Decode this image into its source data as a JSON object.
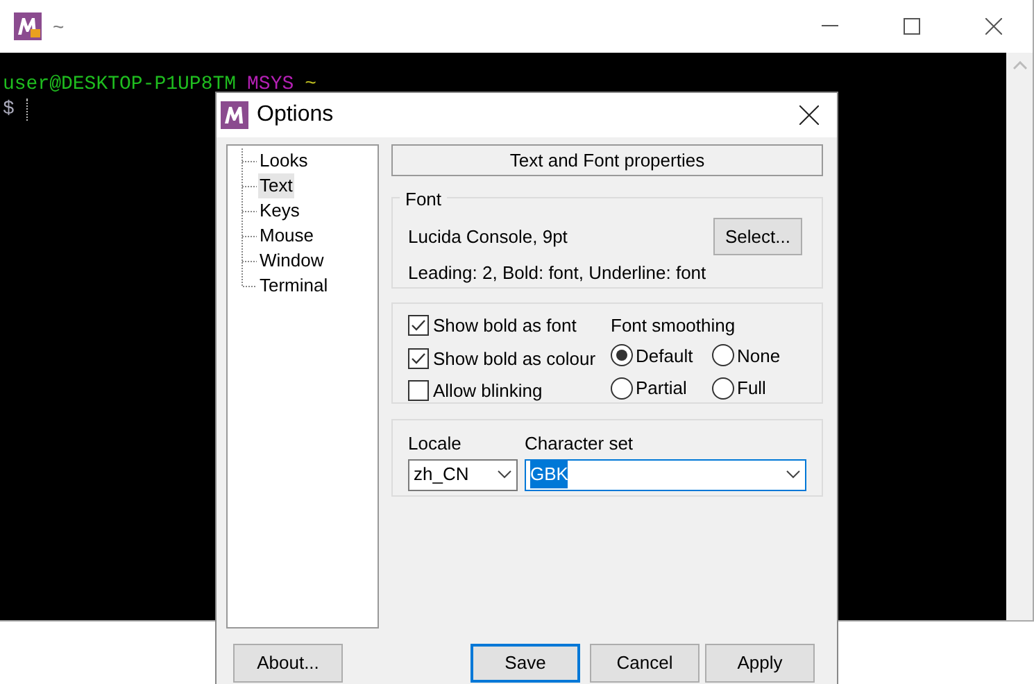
{
  "terminal": {
    "title": "~",
    "line_1": [
      {
        "text": "user@DESKTOP-P1UP8TM",
        "color": "#1fbd1f"
      },
      {
        "text": "MSYS",
        "color": "#b520b5"
      },
      {
        "text": "~",
        "color": "#bfbf20"
      }
    ],
    "prompt": "$"
  },
  "dialog": {
    "title": "Options",
    "tree": [
      {
        "label": "Looks",
        "selected": false
      },
      {
        "label": "Text",
        "selected": true
      },
      {
        "label": "Keys",
        "selected": false
      },
      {
        "label": "Mouse",
        "selected": false
      },
      {
        "label": "Window",
        "selected": false
      },
      {
        "label": "Terminal",
        "selected": false
      }
    ],
    "header": "Text and Font properties",
    "font": {
      "legend": "Font",
      "name": "Lucida Console, 9pt",
      "details": "Leading: 2, Bold: font, Underline: font",
      "button": "Select..."
    },
    "checkboxes": [
      {
        "label": "Show bold as font",
        "checked": true
      },
      {
        "label": "Show bold as colour",
        "checked": true
      },
      {
        "label": "Allow blinking",
        "checked": false
      }
    ],
    "smoothing": {
      "label": "Font smoothing",
      "options": [
        {
          "label": "Default",
          "selected": true
        },
        {
          "label": "None",
          "selected": false
        },
        {
          "label": "Partial",
          "selected": false
        },
        {
          "label": "Full",
          "selected": false
        }
      ]
    },
    "locale": {
      "label": "Locale",
      "value": "zh_CN"
    },
    "charset": {
      "label": "Character set",
      "value": "GBK"
    },
    "buttons": [
      {
        "label": "About...",
        "default": false
      },
      {
        "label": "Save",
        "default": true
      },
      {
        "label": "Cancel",
        "default": false
      },
      {
        "label": "Apply",
        "default": false
      }
    ]
  }
}
